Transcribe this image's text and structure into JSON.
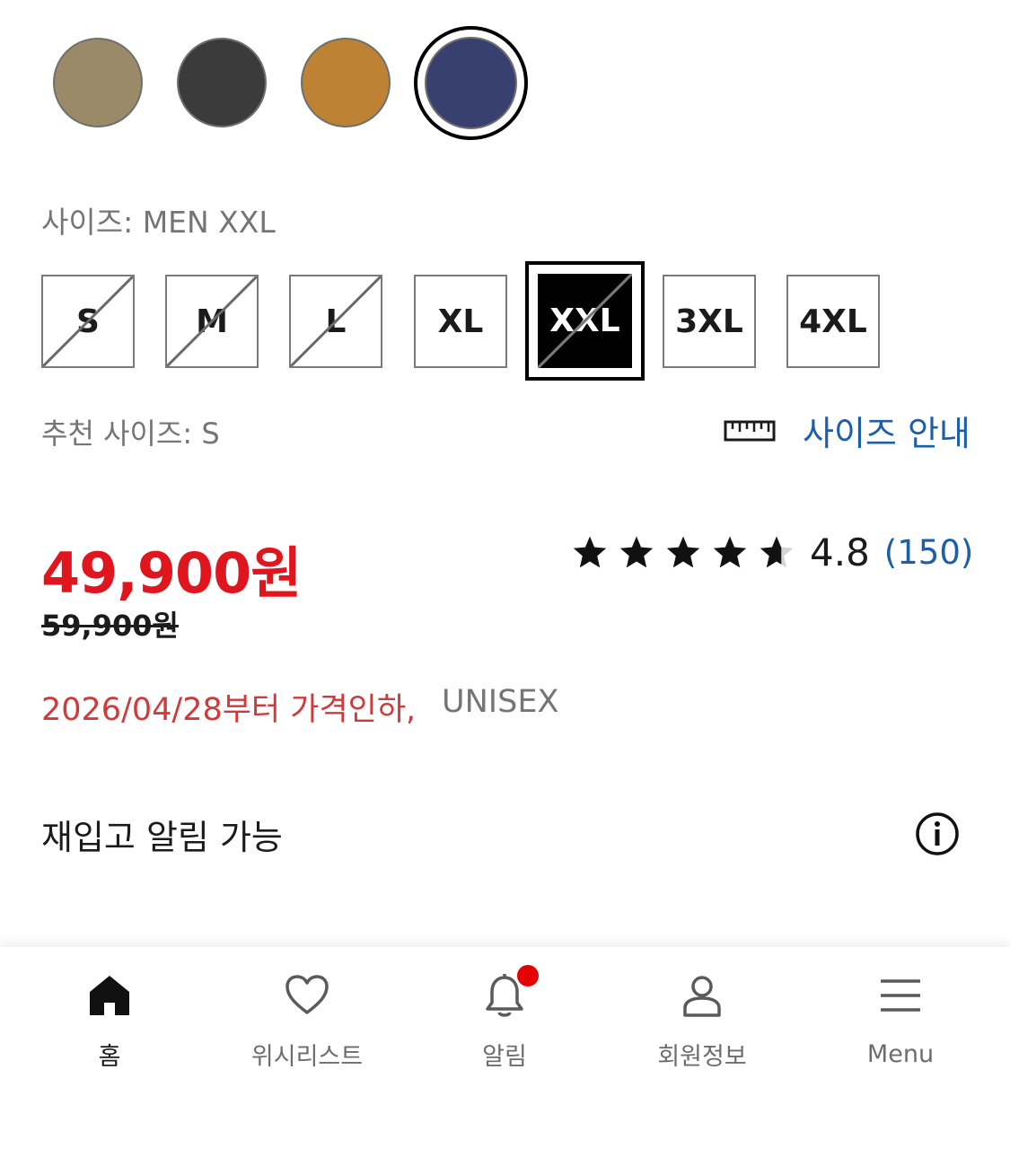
{
  "colors": {
    "swatches": [
      "#9b8a68",
      "#3b3b3b",
      "#bd8233",
      "#37406e"
    ],
    "selected_index": 3,
    "accent_red": "#e0161f",
    "link_blue": "#1d5ea8"
  },
  "size": {
    "label": "사이즈: MEN XXL",
    "options": [
      "S",
      "M",
      "L",
      "XL",
      "XXL",
      "3XL",
      "4XL"
    ],
    "unavailable": [
      "S",
      "M",
      "L",
      "XXL"
    ],
    "selected": "XXL",
    "recommended": "추천 사이즈: S",
    "guide_label": "사이즈 안내",
    "guide_icon": "ruler-icon"
  },
  "price": {
    "current": "49,900원",
    "original": "59,900원"
  },
  "rating": {
    "stars": 4.8,
    "score": "4.8",
    "count": "(150)"
  },
  "promo": {
    "text": "2026/04/28부터 가격인하,",
    "gender": "UNISEX"
  },
  "restock": {
    "text": "재입고 알림 가능",
    "icon": "info-icon"
  },
  "nav": {
    "items": [
      {
        "label": "홈",
        "icon": "home-icon"
      },
      {
        "label": "위시리스트",
        "icon": "heart-icon"
      },
      {
        "label": "알림",
        "icon": "bell-icon"
      },
      {
        "label": "회원정보",
        "icon": "user-icon"
      },
      {
        "label": "Menu",
        "icon": "menu-icon"
      }
    ]
  }
}
